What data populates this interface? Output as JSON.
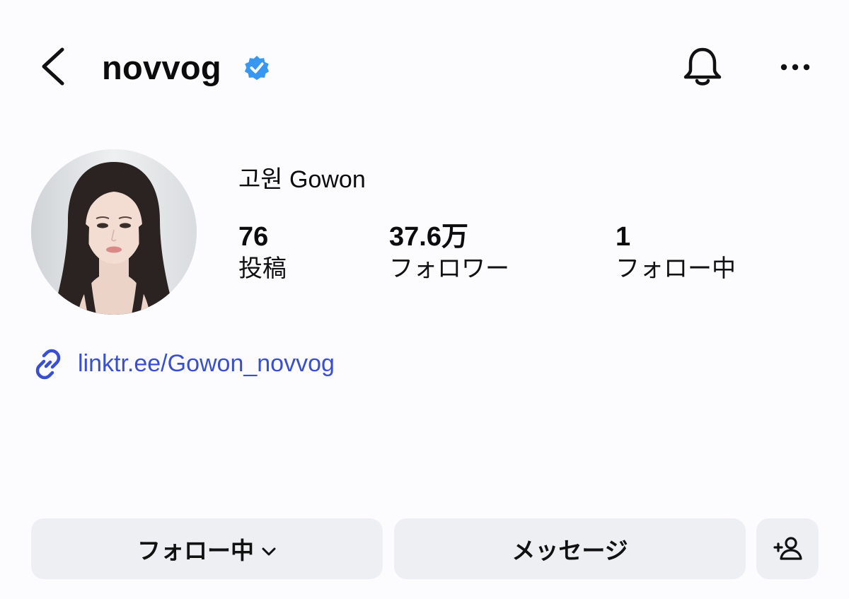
{
  "header": {
    "username": "novvog",
    "verified": true,
    "back_icon": "chevron-left-icon",
    "bell_icon": "bell-icon",
    "more_icon": "more-horizontal-icon"
  },
  "profile": {
    "display_name": "고원 Gowon",
    "stats": [
      {
        "value": "76",
        "label": "投稿"
      },
      {
        "value": "37.6万",
        "label": "フォロワー"
      },
      {
        "value": "1",
        "label": "フォロー中"
      }
    ],
    "link_text": "linktr.ee/Gowon_novvog"
  },
  "actions": {
    "follow_label": "フォロー中",
    "message_label": "メッセージ",
    "add_icon": "add-person-icon"
  },
  "colors": {
    "verified": "#3897f0",
    "link": "#3a4fd0",
    "button_bg": "#eeeff3",
    "background": "#fcfcfe"
  }
}
